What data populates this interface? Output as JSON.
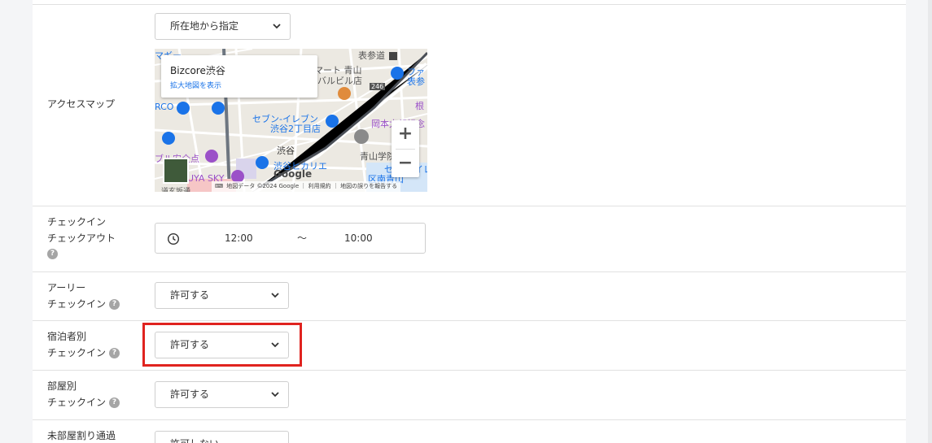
{
  "location_mode": {
    "value": "所在地から指定"
  },
  "access_map": {
    "label": "アクセスマップ",
    "place_name": "Bizcore渋谷",
    "enlarge_link": "拡大地図を表示",
    "zoom_in": "+",
    "zoom_out": "−",
    "google_logo": "Google",
    "attribution": "地図データ ©2024 Google ｜ 利用規約 ｜ 地図の誤りを報告する",
    "map_labels": {
      "omotesando": "表参道",
      "aoyama_mart": "マート 青山",
      "barubiru": "バルビル店",
      "n246": "246",
      "fami": "ファ",
      "omote2": "表参",
      "ne": "根",
      "magi": "マギー",
      "rco": "RCO",
      "seven_shibuya2": "セブン-イレブン",
      "shibuya2": "渋谷2丁目店",
      "okamoto": "岡本太郎記念",
      "shibuya": "渋谷",
      "aoyama_gakuin": "青山学院大",
      "hikarie": "渋谷ヒカリエ",
      "seven_minami": "セブン-イレ",
      "minami": "区南青山",
      "sky": "UYA SKY",
      "kusunoki": "ブル安全点",
      "sakura": "道玄坂通"
    },
    "colors": {
      "road": "#ffffff",
      "rail": "#4a4f57",
      "poi_blue": "#1a73e8",
      "poi_purple": "#9b51c8"
    }
  },
  "checkin_checkout": {
    "label_line1": "チェックイン",
    "label_line2": "チェックアウト",
    "checkin_time": "12:00",
    "separator": "〜",
    "checkout_time": "10:00"
  },
  "early_checkin": {
    "label_line1": "アーリー",
    "label_line2": "チェックイン",
    "value": "許可する"
  },
  "guest_checkin": {
    "label_line1": "宿泊者別",
    "label_line2": "チェックイン",
    "value": "許可する"
  },
  "room_checkin": {
    "label_line1": "部屋別",
    "label_line2": "チェックイン",
    "value": "許可する"
  },
  "unassigned_room": {
    "label_line1": "未部屋割り通過",
    "value": "許可しない"
  },
  "help_glyph": "?",
  "colors": {
    "highlight": "#e0231f",
    "separator": "#e1e1e1",
    "background": "#f4f5f7"
  }
}
